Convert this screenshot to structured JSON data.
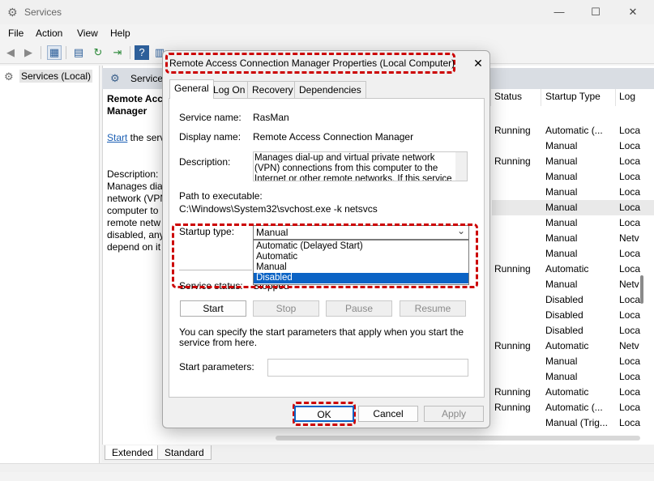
{
  "window": {
    "title": "Services",
    "controls": {
      "minimize": "—",
      "maximize": "☐",
      "close": "✕"
    }
  },
  "menu": [
    "File",
    "Action",
    "View",
    "Help"
  ],
  "tree": {
    "root_label": "Services (Local)"
  },
  "right_header": {
    "title": "Service"
  },
  "description_panel": {
    "service_name_lines": [
      "Remote Acc",
      "Manager"
    ],
    "start_link": "Start",
    "start_suffix": " the serv",
    "description_lines": [
      "Description:",
      "Manages dia",
      "network (VPN",
      "computer to",
      "remote netw",
      "disabled, any",
      "depend on it"
    ]
  },
  "columns": {
    "status": "Status",
    "startup_type": "Startup Type",
    "log_on": "Log"
  },
  "rows": [
    {
      "status": "Running",
      "startup": "Automatic (...",
      "log": "Loca"
    },
    {
      "status": "",
      "startup": "Manual",
      "log": "Loca"
    },
    {
      "status": "Running",
      "startup": "Manual",
      "log": "Loca"
    },
    {
      "status": "",
      "startup": "Manual",
      "log": "Loca"
    },
    {
      "status": "",
      "startup": "Manual",
      "log": "Loca"
    },
    {
      "status": "",
      "startup": "Manual",
      "log": "Loca",
      "selected": true
    },
    {
      "status": "",
      "startup": "Manual",
      "log": "Loca"
    },
    {
      "status": "",
      "startup": "Manual",
      "log": "Netv"
    },
    {
      "status": "",
      "startup": "Manual",
      "log": "Loca"
    },
    {
      "status": "Running",
      "startup": "Automatic",
      "log": "Loca"
    },
    {
      "status": "",
      "startup": "Manual",
      "log": "Netv"
    },
    {
      "status": "",
      "startup": "Disabled",
      "log": "Loca"
    },
    {
      "status": "",
      "startup": "Disabled",
      "log": "Loca"
    },
    {
      "status": "",
      "startup": "Disabled",
      "log": "Loca"
    },
    {
      "status": "Running",
      "startup": "Automatic",
      "log": "Netv"
    },
    {
      "status": "",
      "startup": "Manual",
      "log": "Loca"
    },
    {
      "status": "",
      "startup": "Manual",
      "log": "Loca"
    },
    {
      "status": "Running",
      "startup": "Automatic",
      "log": "Loca"
    },
    {
      "status": "Running",
      "startup": "Automatic (...",
      "log": "Loca"
    },
    {
      "status": "",
      "startup": "Manual (Trig...",
      "log": "Loca"
    }
  ],
  "bottom_tabs": [
    "Extended",
    "Standard"
  ],
  "dialog": {
    "title": "Remote Access Connection Manager Properties (Local Computer)",
    "close": "✕",
    "tabs": [
      "General",
      "Log On",
      "Recovery",
      "Dependencies"
    ],
    "active_tab": "General",
    "service_name_label": "Service name:",
    "service_name": "RasMan",
    "display_name_label": "Display name:",
    "display_name": "Remote Access Connection Manager",
    "description_label": "Description:",
    "description": "Manages dial-up and virtual private network (VPN) connections from this computer to the Internet or other remote networks. If this service is disabled, any",
    "path_label": "Path to executable:",
    "path": "C:\\Windows\\System32\\svchost.exe -k netsvcs",
    "startup_label": "Startup type:",
    "startup_value": "Manual",
    "startup_options": [
      "Automatic (Delayed Start)",
      "Automatic",
      "Manual",
      "Disabled"
    ],
    "startup_highlighted": "Disabled",
    "status_label": "Service status:",
    "status_value": "Stopped",
    "buttons": {
      "start": "Start",
      "stop": "Stop",
      "pause": "Pause",
      "resume": "Resume"
    },
    "hint": "You can specify the start parameters that apply when you start the service from here.",
    "params_label": "Start parameters:",
    "footer": {
      "ok": "OK",
      "cancel": "Cancel",
      "apply": "Apply"
    }
  },
  "colors": {
    "highlight": "#cc0000",
    "selection": "#0b63c5",
    "link": "#1b5fb4"
  }
}
